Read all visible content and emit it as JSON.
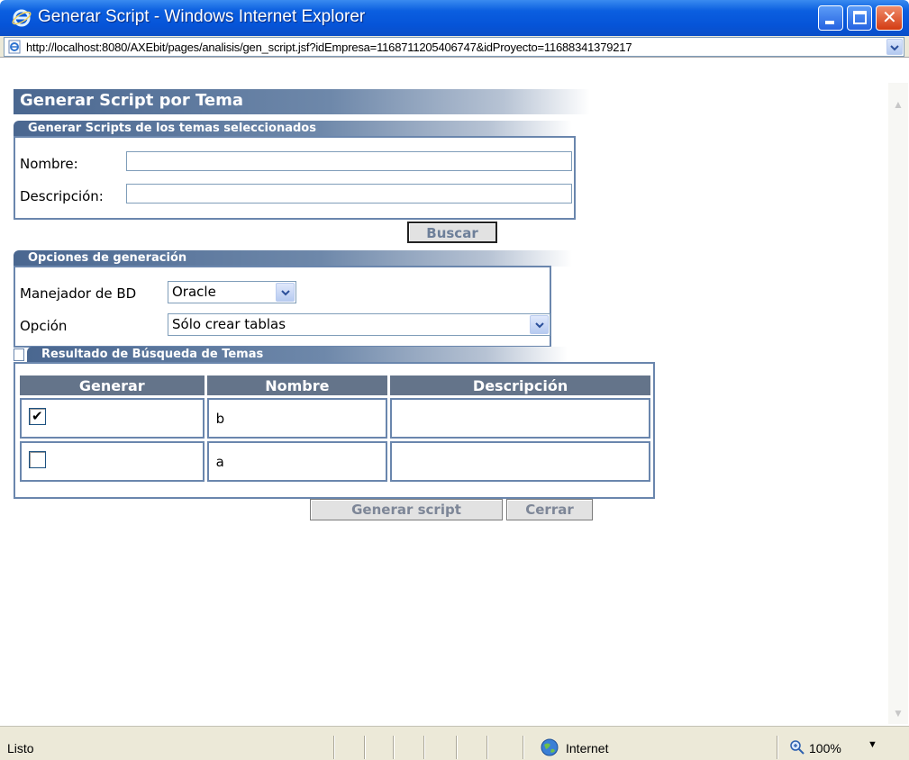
{
  "window": {
    "title": "Generar Script - Windows Internet Explorer",
    "url": "http://localhost:8080/AXEbit/pages/analisis/gen_script.jsf?idEmpresa=1168711205406747&idProyecto=11688341379217"
  },
  "page": {
    "heading": "Generar Script por Tema"
  },
  "search": {
    "section_title": "Generar Scripts de los temas seleccionados",
    "nombre_label": "Nombre:",
    "nombre_value": "",
    "descripcion_label": "Descripción:",
    "descripcion_value": "",
    "buscar_label": "Buscar"
  },
  "options": {
    "section_title": "Opciones de generación",
    "manejador_label": "Manejador de BD",
    "manejador_value": "Oracle",
    "opcion_label": "Opción",
    "opcion_value": "Sólo crear tablas"
  },
  "results": {
    "section_title": "Resultado de Búsqueda de Temas",
    "columns": [
      "Generar",
      "Nombre",
      "Descripción"
    ],
    "rows": [
      {
        "checked": true,
        "nombre": "b",
        "descripcion": ""
      },
      {
        "checked": false,
        "nombre": "a",
        "descripcion": ""
      }
    ]
  },
  "actions": {
    "generar_label": "Generar script",
    "cerrar_label": "Cerrar"
  },
  "statusbar": {
    "status": "Listo",
    "zone": "Internet",
    "zoom": "100%"
  },
  "icons": {
    "app": "internet-explorer-icon",
    "page": "page-icon",
    "zone": "globe-icon",
    "zoom": "zoom-icon",
    "check": "checkmark"
  },
  "colors": {
    "titlebar": "#0654d8",
    "section_header": "#4a6790",
    "table_header": "#64748a",
    "panel_border": "#6a86ad",
    "button_text": "#6d7f99"
  }
}
